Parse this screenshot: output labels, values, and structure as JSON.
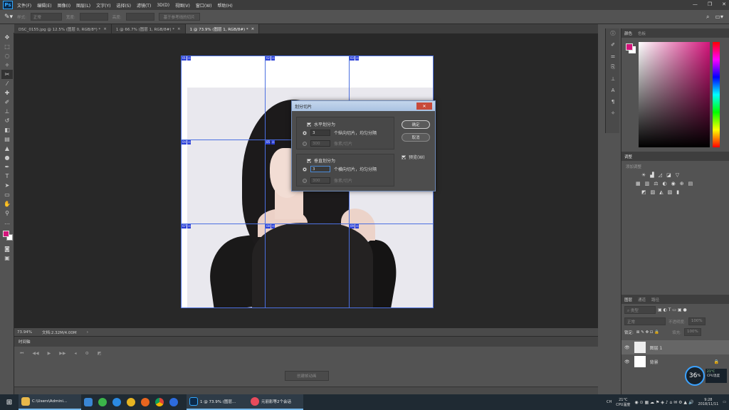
{
  "menubar": {
    "logo": "Ps",
    "items": [
      "文件(F)",
      "编辑(E)",
      "图像(I)",
      "图层(L)",
      "文字(Y)",
      "选择(S)",
      "滤镜(T)",
      "3D(D)",
      "视图(V)",
      "窗口(W)",
      "帮助(H)"
    ]
  },
  "options": {
    "style_label": "样式:",
    "style_value": "正常",
    "width_label": "宽度:",
    "height_label": "高度:",
    "guide_button": "基于参考线的切片"
  },
  "tabs": [
    {
      "label": "DSC_0155.jpg @ 12.5% (图层 0, RGB/8*) *",
      "close": "×"
    },
    {
      "label": "1 @ 66.7% (图层 1, RGB/8#) *",
      "close": "×"
    },
    {
      "label": "1 @ 73.9% (图层 1, RGB/8#) *",
      "close": "×"
    }
  ],
  "slices": [
    {
      "num": "01"
    },
    {
      "num": "02"
    },
    {
      "num": "03"
    },
    {
      "num": "04"
    },
    {
      "num": "05"
    },
    {
      "num": "06"
    },
    {
      "num": "07"
    },
    {
      "num": "08"
    },
    {
      "num": "09"
    }
  ],
  "status": {
    "zoom": "73.94%",
    "doc": "文档:2.32M/4.00M"
  },
  "timeline": {
    "title": "时间轴",
    "create_button": "创建帧动画"
  },
  "dialog": {
    "title": "划分切片",
    "h_check": "水平划分为",
    "h_value": "3",
    "h_suffix": "个纵向切片，均匀分隔",
    "h_px": "300",
    "h_px_suffix": "像素/切片",
    "v_check": "垂直划分为",
    "v_value": "3",
    "v_suffix": "个横向切片，均匀分隔",
    "v_px": "300",
    "v_px_suffix": "像素/切片",
    "ok": "确定",
    "cancel": "取消",
    "preview": "预览(W)"
  },
  "panels": {
    "color_tabs": [
      "颜色",
      "色板"
    ],
    "adjust_title": "调整",
    "adjust_sub": "添加调整",
    "layers_tabs": [
      "图层",
      "通道",
      "路径"
    ],
    "kind": "类型",
    "blend": "正常",
    "opacity_label": "不透明度:",
    "opacity": "100%",
    "lock_label": "锁定:",
    "fill_label": "填充:",
    "fill": "100%",
    "layers": [
      {
        "name": "图层 1"
      },
      {
        "name": "背景"
      }
    ]
  },
  "colors": {
    "foreground": "#d4157b",
    "background": "#ffffff",
    "accent": "#31a8ff"
  },
  "taskbar": {
    "explorer": "C:\\Users\\Admini...",
    "ps_window": "1 @ 73.9% (图层...",
    "chat_window": "元丽影等2个会话",
    "temp": "21°C",
    "temp_label": "CPU温度",
    "time": "9:28",
    "date": "2018/11/11",
    "ime": "CH"
  },
  "cpu": {
    "percent": "36",
    "unit": "%",
    "temp": "21°C",
    "label": "CPU温度"
  }
}
